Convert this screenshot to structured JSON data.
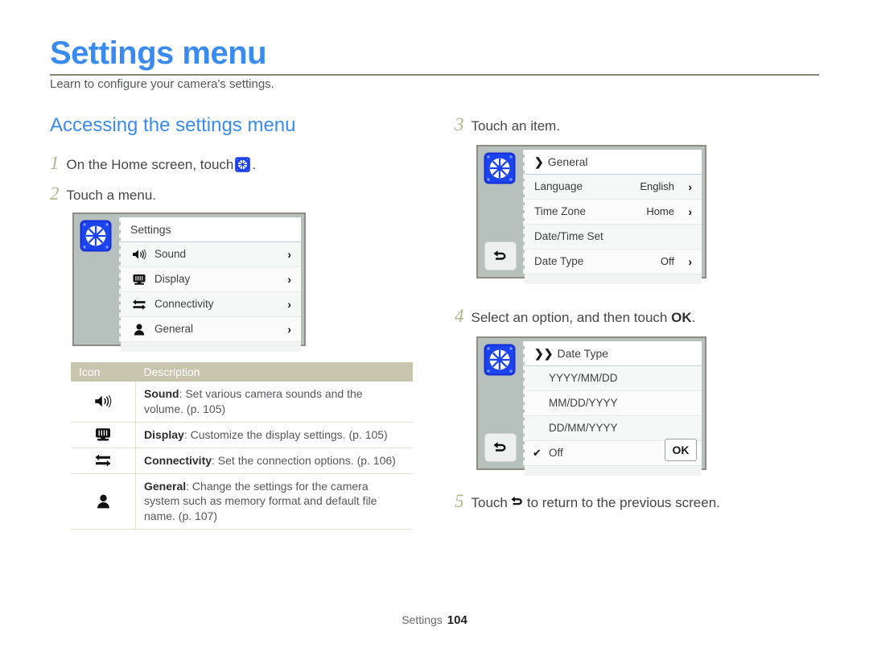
{
  "document": {
    "title": "Settings menu",
    "subtitle": "Learn to configure your camera's settings.",
    "section_heading": "Accessing the settings menu",
    "accent_color": "#3a8bf0",
    "step_number_color": "#a9bb88",
    "table_header_color": "#c7c5ae"
  },
  "footer": {
    "label": "Settings",
    "page_number": "104"
  },
  "steps": {
    "one": {
      "number": "1",
      "text_before": "On the Home screen, touch",
      "icon": "settings-gear-icon",
      "text_after": "."
    },
    "two": {
      "number": "2",
      "text": "Touch a menu."
    },
    "three": {
      "number": "3",
      "text": "Touch an item."
    },
    "four": {
      "number": "4",
      "text_before": "Select an option, and then touch",
      "emphasis": "OK",
      "text_after": "."
    },
    "five": {
      "number": "5",
      "text_before": "Touch",
      "icon": "back-arrow-icon",
      "text_after": "to return to the previous screen."
    }
  },
  "dialog_settings": {
    "title": "Settings",
    "title_chevron": "",
    "badge_icon": "settings-gear-icon",
    "rows": [
      {
        "icon": "speaker-icon",
        "label": "Sound",
        "value": "",
        "arrow": "›"
      },
      {
        "icon": "display-icon",
        "label": "Display",
        "value": "",
        "arrow": "›"
      },
      {
        "icon": "connectivity-icon",
        "label": "Connectivity",
        "value": "",
        "arrow": "›"
      },
      {
        "icon": "person-icon",
        "label": "General",
        "value": "",
        "arrow": "›"
      }
    ]
  },
  "dialog_general": {
    "title": "General",
    "title_chevron": "❯",
    "badge_icon": "settings-gear-icon",
    "back_icon": "back-arrow-icon",
    "rows": [
      {
        "label": "Language",
        "value": "English",
        "arrow": "›"
      },
      {
        "label": "Time Zone",
        "value": "Home",
        "arrow": "›"
      },
      {
        "label": "Date/Time Set",
        "value": "",
        "arrow": ""
      },
      {
        "label": "Date Type",
        "value": "Off",
        "arrow": "›"
      }
    ]
  },
  "dialog_date_type": {
    "title": "Date Type",
    "title_chevron": "❯❯",
    "badge_icon": "settings-gear-icon",
    "back_icon": "back-arrow-icon",
    "ok_label": "OK",
    "rows": [
      {
        "label": "YYYY/MM/DD",
        "selected": false,
        "check": ""
      },
      {
        "label": "MM/DD/YYYY",
        "selected": false,
        "check": ""
      },
      {
        "label": "DD/MM/YYYY",
        "selected": false,
        "check": ""
      },
      {
        "label": "Off",
        "selected": true,
        "check": "✔"
      }
    ]
  },
  "table": {
    "headers": {
      "icon": "Icon",
      "description": "Description"
    },
    "rows": [
      {
        "icon": "speaker-icon",
        "term": "Sound",
        "desc": ": Set various camera sounds and the volume. (p. 105)"
      },
      {
        "icon": "display-icon",
        "term": "Display",
        "desc": ": Customize the display settings. (p. 105)"
      },
      {
        "icon": "connectivity-icon",
        "term": "Connectivity",
        "desc": ": Set the connection options. (p. 106)"
      },
      {
        "icon": "person-icon",
        "term": "General",
        "desc": ": Change the settings for the camera system such as memory format and default file name. (p. 107)"
      }
    ]
  }
}
